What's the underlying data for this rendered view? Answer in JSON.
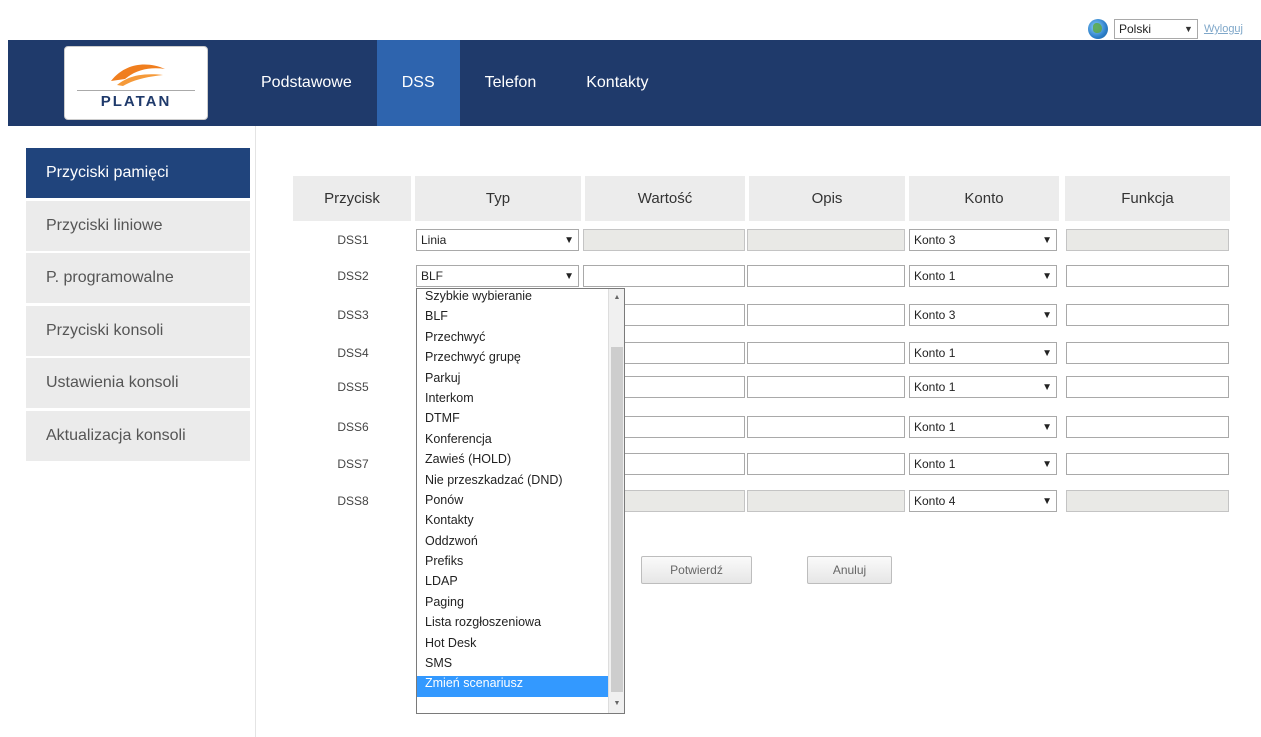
{
  "language": {
    "selected": "Polski",
    "logout_label": "Wyloguj"
  },
  "logo": {
    "text": "PLATAN"
  },
  "nav": {
    "items": [
      "Podstawowe",
      "DSS",
      "Telefon",
      "Kontakty"
    ],
    "active": "DSS"
  },
  "sidebar": {
    "items": [
      "Przyciski pamięci",
      "Przyciski liniowe",
      "P. programowalne",
      "Przyciski konsoli",
      "Ustawienia konsoli",
      "Aktualizacja konsoli"
    ],
    "active": "Przyciski pamięci"
  },
  "table": {
    "headers": [
      "Przycisk",
      "Typ",
      "Wartość",
      "Opis",
      "Konto",
      "Funkcja"
    ],
    "rows": [
      {
        "button": "DSS1",
        "type": "Linia",
        "account": "Konto 3",
        "disabled": true
      },
      {
        "button": "DSS2",
        "type": "BLF",
        "account": "Konto 1",
        "disabled": false
      },
      {
        "button": "DSS3",
        "type": "",
        "account": "Konto 3",
        "disabled": false
      },
      {
        "button": "DSS4",
        "type": "",
        "account": "Konto 1",
        "disabled": false
      },
      {
        "button": "DSS5",
        "type": "",
        "account": "Konto 1",
        "disabled": false
      },
      {
        "button": "DSS6",
        "type": "",
        "account": "Konto 1",
        "disabled": false
      },
      {
        "button": "DSS7",
        "type": "",
        "account": "Konto 1",
        "disabled": false
      },
      {
        "button": "DSS8",
        "type": "",
        "account": "Konto 4",
        "disabled": true
      }
    ]
  },
  "type_dropdown": {
    "options": [
      "Szybkie wybieranie",
      "BLF",
      "Przechwyć",
      "Przechwyć grupę",
      "Parkuj",
      "Interkom",
      "DTMF",
      "Konferencja",
      "Zawieś (HOLD)",
      "Nie przeszkadzać (DND)",
      "Ponów",
      "Kontakty",
      "Oddzwoń",
      "Prefiks",
      "LDAP",
      "Paging",
      "Lista rozgłoszeniowa",
      "Hot Desk",
      "SMS",
      "Zmień scenariusz"
    ],
    "highlighted": "Zmień scenariusz"
  },
  "buttons": {
    "confirm": "Potwierdź",
    "cancel": "Anuluj"
  },
  "colors": {
    "header_bg": "#1f3a6b",
    "nav_active": "#2e64ae",
    "sidebar_active": "#20447c",
    "selection": "#3399ff"
  }
}
